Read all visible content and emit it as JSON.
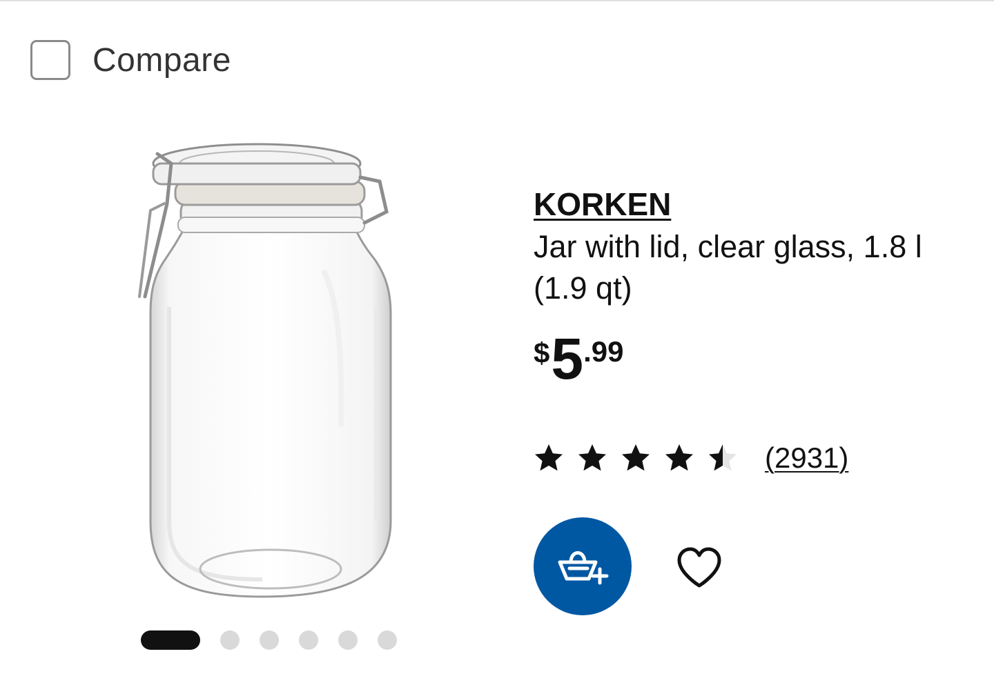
{
  "compare": {
    "label": "Compare",
    "checked": false
  },
  "product": {
    "name": "KORKEN",
    "description": "Jar with lid, clear glass, 1.8 l (1.9 qt)",
    "price": {
      "currency": "$",
      "integer": "5",
      "decimal": ".99"
    },
    "rating": {
      "value": 4.5,
      "max": 5,
      "count_label": "(2931)"
    },
    "image_icon": "glass-jar"
  },
  "carousel": {
    "total": 6,
    "active": 0
  },
  "actions": {
    "add_to_cart_icon": "basket-plus-icon",
    "favorite_icon": "heart-outline-icon"
  },
  "colors": {
    "accent": "#0058a3",
    "text": "#111111",
    "dot_inactive": "#d9d9d9"
  }
}
